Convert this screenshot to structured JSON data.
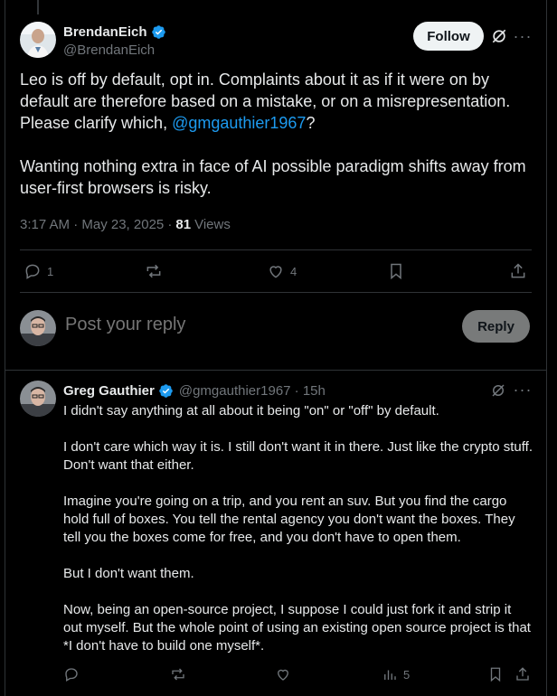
{
  "main_tweet": {
    "author_name": "BrendanEich",
    "author_handle": "@BrendanEich",
    "follow_label": "Follow",
    "text_before_mention": "Leo is off by default, opt in. Complaints about it as if it were on by default are therefore based on a mistake, or on a misrepresentation. Please clarify which, ",
    "mention": "@gmgauthier1967",
    "text_after_mention": "?\n\nWanting nothing extra in face of AI possible paradigm shifts away from user-first browsers is risky.",
    "timestamp": "3:17 AM · May 23, 2025 · ",
    "views_count": "81",
    "views_label": "Views",
    "replies": "1",
    "reposts": "",
    "likes": "4"
  },
  "reply_box": {
    "placeholder": "Post your reply",
    "button_label": "Reply"
  },
  "reply_tweet": {
    "author_name": "Greg Gauthier",
    "author_handle_time": "@gmgauthier1967 · 15h",
    "text": "I didn't say anything at all about it being \"on\" or \"off\" by default.\n\nI don't care which way it is. I still don't want it in there. Just like the crypto stuff. Don't want that either.\n\nImagine you're going on a trip, and you rent an suv. But you find the cargo hold full of boxes. You tell the rental agency you don't want the boxes. They tell you the boxes come for free, and you don't have to open them.\n\nBut I don't want them.\n\nNow, being an open-source project, I suppose I could just fork it and strip it out myself. But the whole point of using an existing open source project is that *I don't have to build one myself*.",
    "views": "5"
  },
  "colors": {
    "background": "#000000",
    "text": "#e7e9ea",
    "muted": "#71767b",
    "accent": "#1d9bf0",
    "border": "#2f3336"
  }
}
